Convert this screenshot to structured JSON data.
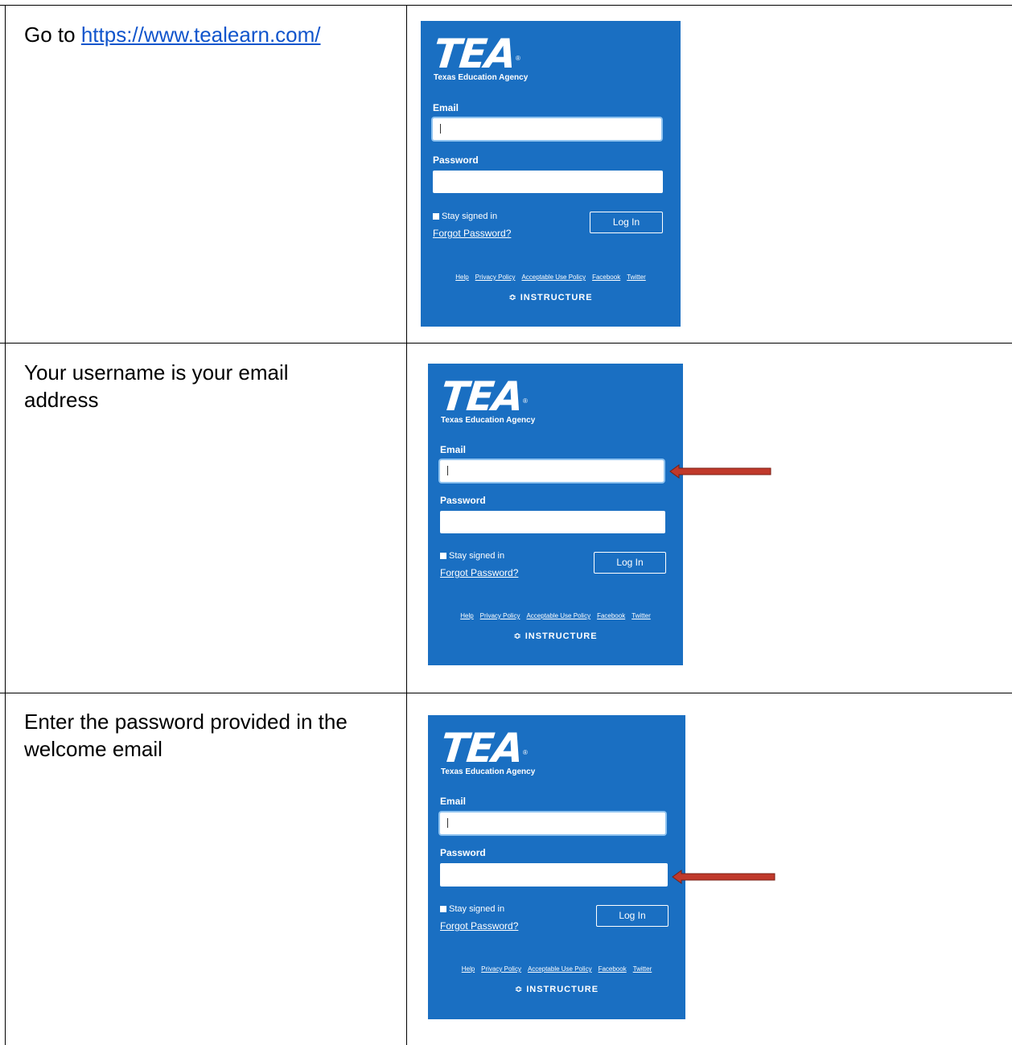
{
  "steps": [
    {
      "text_prefix": "Go to ",
      "link": "https://www.tealearn.com/"
    },
    {
      "text": "Your username is your email address"
    },
    {
      "text": "Enter the password provided in the welcome email"
    }
  ],
  "login_screen": {
    "logo_text": "TEA",
    "logo_subtitle": "Texas Education Agency",
    "registered_mark": "®",
    "email_label": "Email",
    "password_label": "Password",
    "stay_signed_in": "Stay signed in",
    "forgot_password": "Forgot Password?",
    "login_button": "Log In",
    "footer_links": [
      "Help",
      "Privacy Policy",
      "Acceptable Use Policy",
      "Facebook",
      "Twitter"
    ],
    "brand": "INSTRUCTURE",
    "brand_color": "#1a6fc2"
  },
  "arrow_color": "#c0392b"
}
